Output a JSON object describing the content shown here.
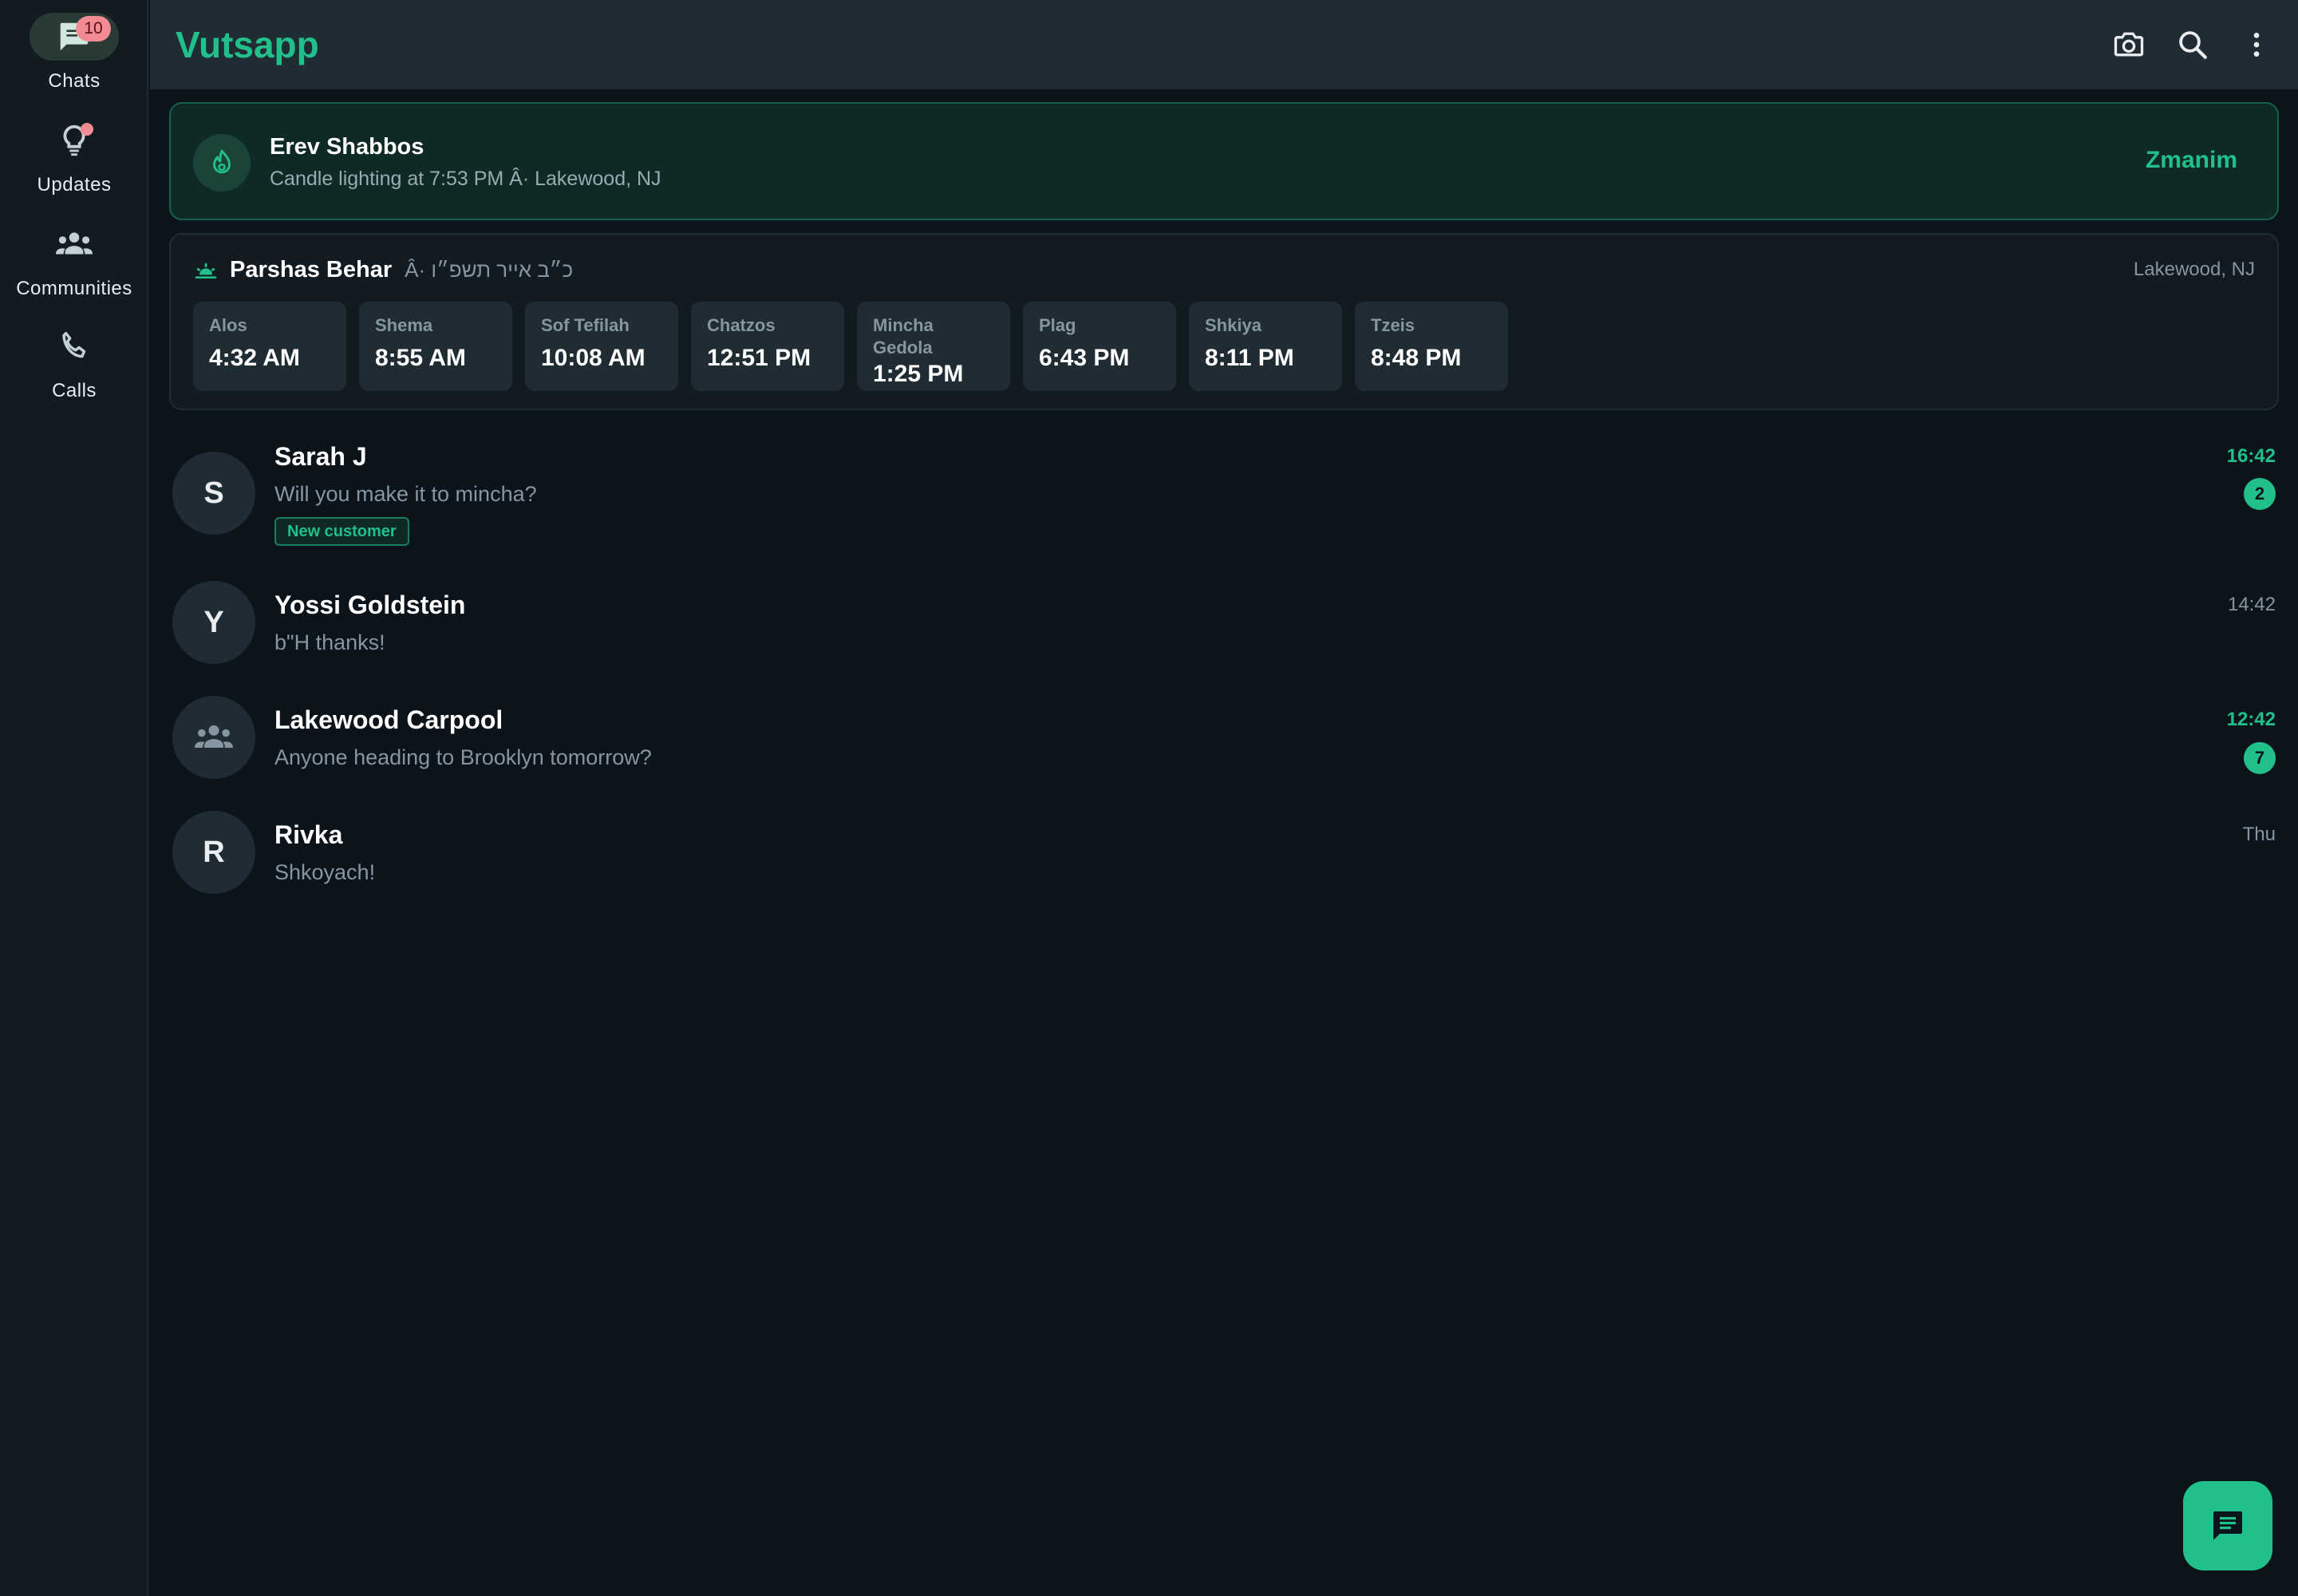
{
  "app": {
    "title": "Vutsapp"
  },
  "nav": {
    "items": [
      {
        "label": "Chats",
        "icon": "chat-icon",
        "badge": "10",
        "active": true
      },
      {
        "label": "Updates",
        "icon": "updates-icon",
        "dot": true
      },
      {
        "label": "Communities",
        "icon": "communities-icon"
      },
      {
        "label": "Calls",
        "icon": "phone-icon"
      }
    ]
  },
  "toolbar": {
    "icons": [
      "camera-icon",
      "search-icon",
      "more-vertical-icon"
    ]
  },
  "banner": {
    "title": "Erev Shabbos",
    "subtitle": "Candle lighting at 7:53 PM Â· Lakewood, NJ",
    "action": "Zmanim",
    "icon": "candle-icon"
  },
  "zmanim": {
    "parsha": "Parshas Behar",
    "hebrew_date": "Â· כ״ב אייר תשפ״ו",
    "location": "Lakewood, NJ",
    "icon": "sunrise-icon",
    "times": [
      {
        "name": "Alos",
        "time": "4:32 AM"
      },
      {
        "name": "Shema",
        "time": "8:55 AM"
      },
      {
        "name": "Sof Tefilah",
        "time": "10:08 AM"
      },
      {
        "name": "Chatzos",
        "time": "12:51 PM"
      },
      {
        "name": "Mincha Gedola",
        "time": "1:25 PM"
      },
      {
        "name": "Plag",
        "time": "6:43 PM"
      },
      {
        "name": "Shkiya",
        "time": "8:11 PM"
      },
      {
        "name": "Tzeis",
        "time": "8:48 PM"
      }
    ]
  },
  "chats": [
    {
      "initial": "S",
      "name": "Sarah J",
      "message": "Will you make it to mincha?",
      "tag": "New customer",
      "time": "16:42",
      "unread": "2"
    },
    {
      "initial": "Y",
      "name": "Yossi Goldstein",
      "message": "b\"H thanks!",
      "time": "14:42"
    },
    {
      "initial": "",
      "avatar_icon": "group-icon",
      "name": "Lakewood Carpool",
      "message": "Anyone heading to Brooklyn tomorrow?",
      "time": "12:42",
      "unread": "7"
    },
    {
      "initial": "R",
      "name": "Rivka",
      "message": "Shkoyach!",
      "time": "Thu"
    }
  ],
  "fab": {
    "icon": "new-chat-icon"
  },
  "colors": {
    "accent": "#21c08b",
    "background": "#0b141a",
    "panel": "#111b21",
    "badge": "#f28b94"
  }
}
